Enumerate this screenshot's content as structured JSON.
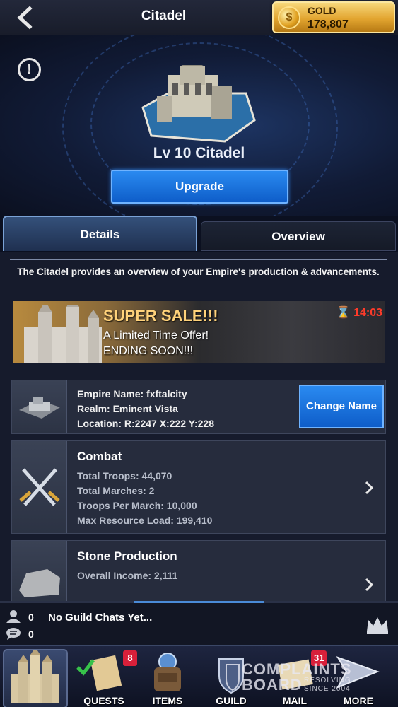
{
  "header": {
    "title": "Citadel",
    "gold_label": "GOLD",
    "gold_value": "178,807",
    "coin_glyph": "$"
  },
  "hero": {
    "level_title": "Lv 10 Citadel",
    "upgrade_label": "Upgrade",
    "info_glyph": "!"
  },
  "tabs": [
    {
      "label": "Details",
      "active": true
    },
    {
      "label": "Overview",
      "active": false
    }
  ],
  "description": "The Citadel provides an overview of your Empire's production & advancements.",
  "sale": {
    "title": "SUPER SALE!!!",
    "line1": "A Limited Time Offer!",
    "line2": "ENDING SOON!!!",
    "timer": "14:03",
    "timer_icon": "hourglass-icon"
  },
  "empire": {
    "name_line": "Empire Name: fxftalcity",
    "realm_line": "Realm: Eminent Vista",
    "location_line": "Location: R:2247 X:222 Y:228",
    "change_label": "Change Name"
  },
  "combat": {
    "title": "Combat",
    "lines": [
      "Total Troops: 44,070",
      "Total Marches: 2",
      "Troops Per March: 10,000",
      "Max Resource Load: 199,410"
    ]
  },
  "stone": {
    "title": "Stone Production",
    "lines": [
      "Overall Income: 2,111"
    ]
  },
  "chat": {
    "online_count": "0",
    "message_count": "0",
    "text": "No Guild Chats Yet..."
  },
  "nav": {
    "items": [
      {
        "label": "QUESTS",
        "badge": "8"
      },
      {
        "label": "ITEMS",
        "badge": ""
      },
      {
        "label": "GUILD",
        "badge": ""
      },
      {
        "label": "MAIL",
        "badge": "31"
      },
      {
        "label": "MORE",
        "badge": ""
      }
    ]
  },
  "watermark": {
    "line1": "COMPLAINTS",
    "line2": "BOARD",
    "tag1": "RESOLVING",
    "tag2": "SINCE 2004"
  },
  "colors": {
    "accent_blue": "#1476e6",
    "gold": "#e2a530",
    "badge_red": "#d8203a",
    "timer_red": "#ff3b2a"
  }
}
